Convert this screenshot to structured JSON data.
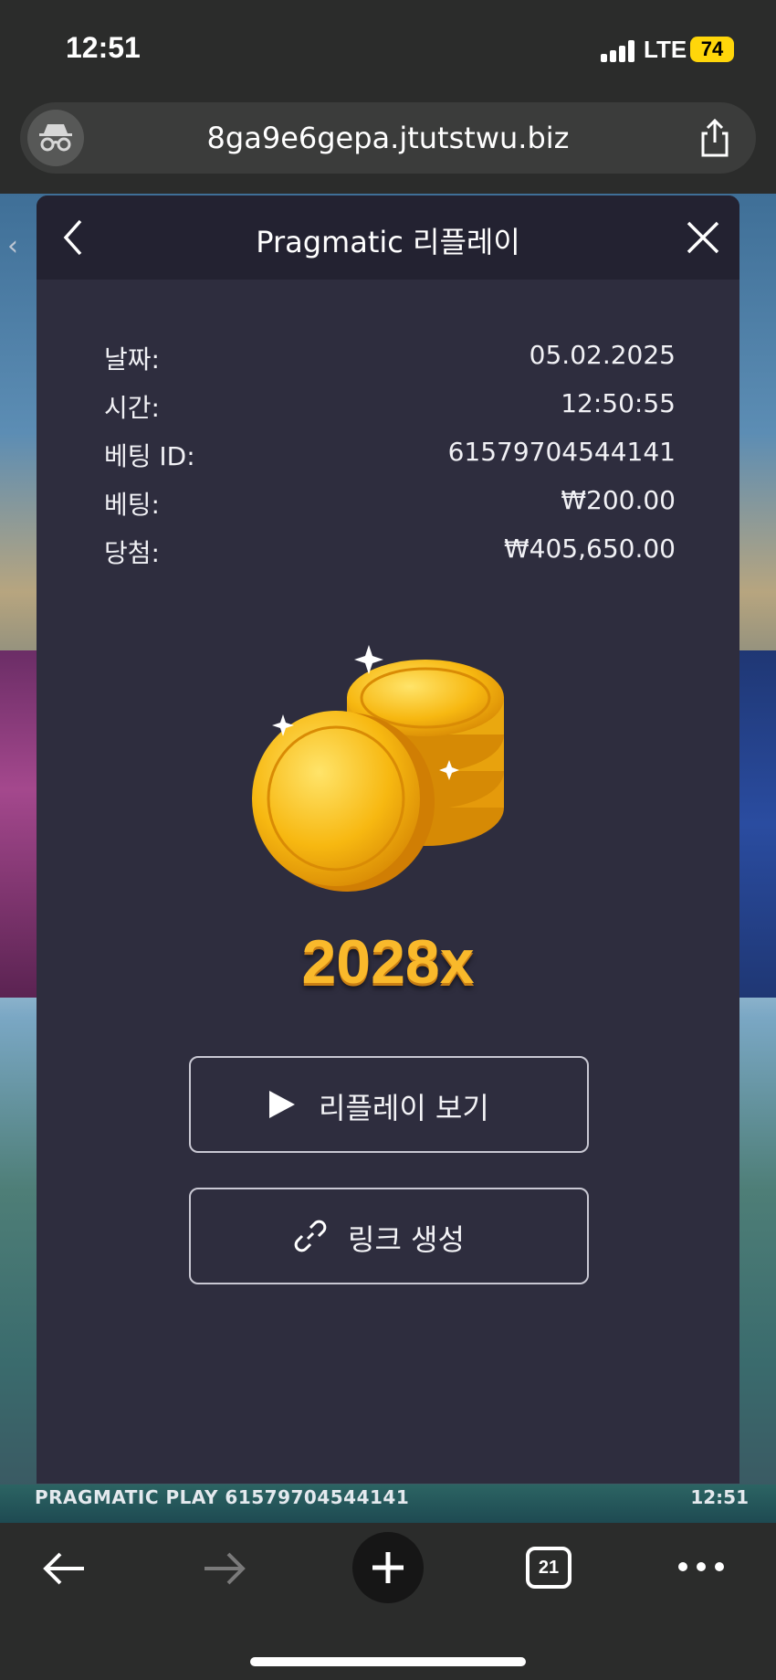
{
  "status_bar": {
    "time": "12:51",
    "network": "LTE",
    "battery": "74"
  },
  "browser": {
    "url": "8ga9e6gepa.jtutstwu.biz",
    "tab_count": "21"
  },
  "modal": {
    "title": "Pragmatic 리플레이",
    "rows": [
      {
        "label": "날짜:",
        "value": "05.02.2025"
      },
      {
        "label": "시간:",
        "value": "12:50:55"
      },
      {
        "label": "베팅 ID:",
        "value": "61579704544141"
      },
      {
        "label": "베팅:",
        "value": "₩200.00"
      },
      {
        "label": "당첨:",
        "value": "₩405,650.00"
      }
    ],
    "multiplier": "2028x",
    "replay_button": "리플레이 보기",
    "link_button": "링크 생성"
  },
  "game_footer": {
    "left": "PRAGMATIC PLAY  61579704544141",
    "right": "12:51"
  },
  "colors": {
    "modal_bg": "#2e2d3e",
    "header_bg": "#232231",
    "gold": "#f9b92b",
    "battery": "#ffd60a"
  }
}
